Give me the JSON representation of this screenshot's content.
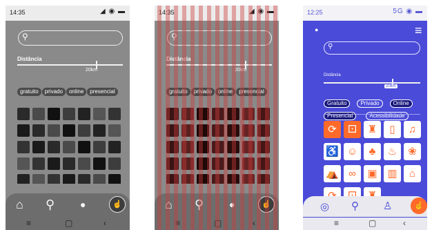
{
  "phones": [
    {
      "time": "14:35",
      "status_icons": "◢ ◉ ▬",
      "search_icon": "search-icon",
      "distance_label": "Distância",
      "distance_value": "20km",
      "distance_fraction": 0.75,
      "chips": [
        "gratuito",
        "privado",
        "online",
        "presencial"
      ],
      "nav_icons": [
        "home-icon",
        "search-icon",
        "user-icon",
        "hand-tap-icon"
      ],
      "system_icons": [
        "menu-icon",
        "home-square-icon",
        "back-icon"
      ]
    },
    {
      "time": "14:35",
      "status_icons": "◢ ◉ ▬",
      "distance_label": "Distância",
      "distance_value": "20km",
      "distance_fraction": 0.75,
      "chips": [
        "gratuito",
        "privado",
        "online",
        "presencial"
      ]
    },
    {
      "time": "12:25",
      "status_icons": "5G ◉ ▬",
      "distance_label": "Distância",
      "distance_value": "20km",
      "distance_fraction": 0.75,
      "chips_row1": [
        "Gratuito",
        "Privado",
        "Online"
      ],
      "chips_row2": [
        "Presencial",
        "Acessibilidade"
      ],
      "tile_icons": [
        "refresh-icon",
        "dice-icon",
        "castle-icon",
        "book-icon",
        "music-icon",
        "accessibility-icon",
        "theater-masks-icon",
        "tree-icon",
        "hot-food-icon",
        "paw-icon",
        "tent-icon",
        "mask-icon",
        "picture-icon",
        "building-icon",
        "museum-icon"
      ],
      "colors": {
        "accent": "#4a4bd8",
        "highlight": "#ff6a2a",
        "dark_chip": "#17177c"
      }
    }
  ],
  "glyphs": {
    "search": "⚲",
    "home": "⌂",
    "user": "●",
    "hand": "☝",
    "menu": "≡",
    "square": "▢",
    "back": "‹",
    "hamburger": "≡",
    "info": "●",
    "compass": "◎",
    "person": "♙",
    "refresh": "⟳",
    "dice": "⚀",
    "castle": "♜",
    "book": "▯",
    "music": "♫",
    "access": "♿",
    "masks": "☺",
    "tree": "♣",
    "food": "♨",
    "paw": "❀",
    "tent": "⛺",
    "mask": "∞",
    "picture": "▣",
    "building": "▥",
    "museum": "⌂"
  }
}
